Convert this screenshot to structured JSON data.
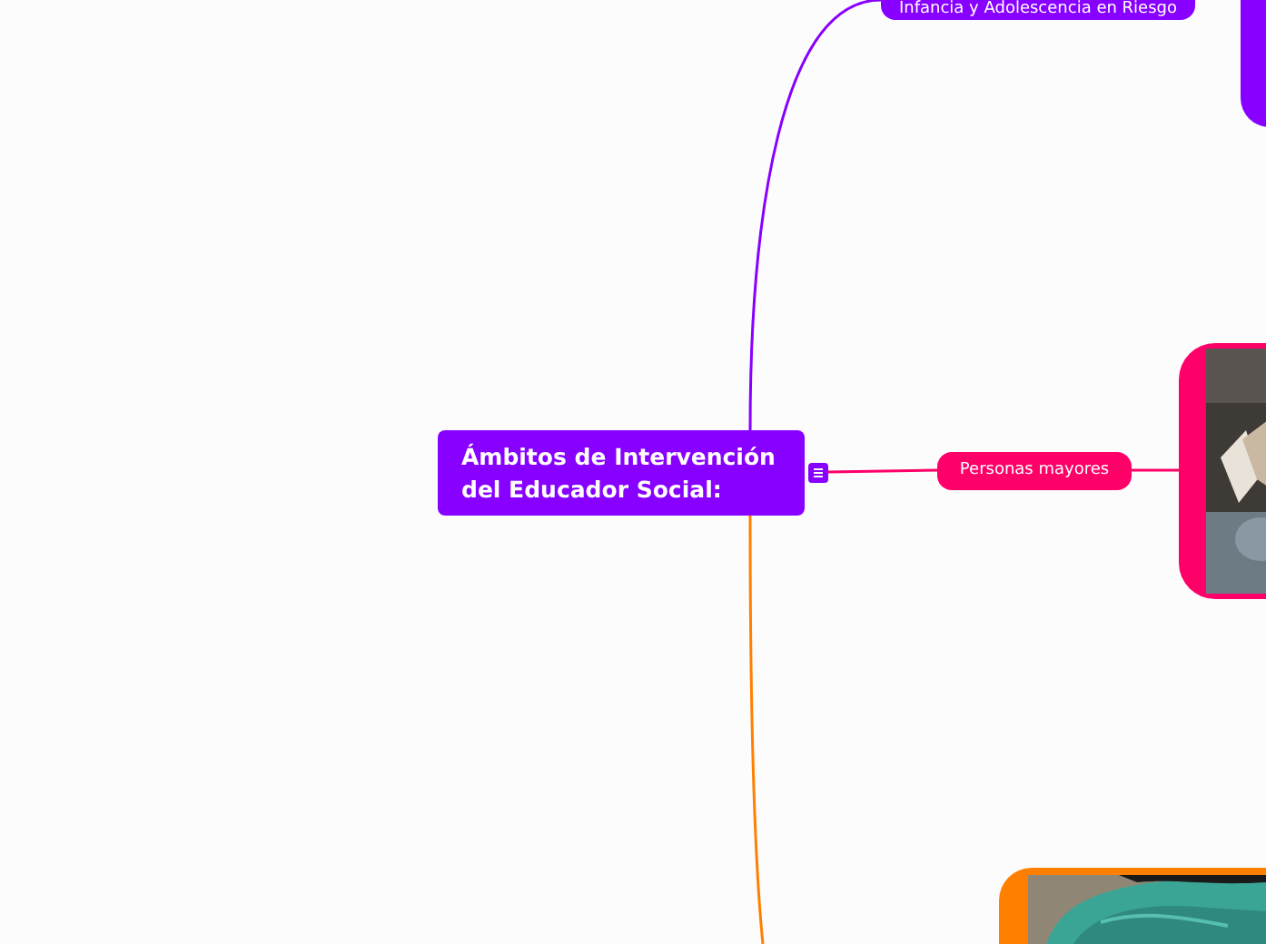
{
  "central_topic": {
    "title": "Ámbitos de Intervención del Educador Social:",
    "color": "#8800ff"
  },
  "branches": [
    {
      "label": "Infancia y Adolescencia en Riesgo",
      "color": "#8800ff",
      "kind": "picture"
    },
    {
      "label": "Personas mayores",
      "color": "#ff0068",
      "kind": "picture"
    },
    {
      "color": "#ff8000",
      "kind": "picture"
    }
  ]
}
